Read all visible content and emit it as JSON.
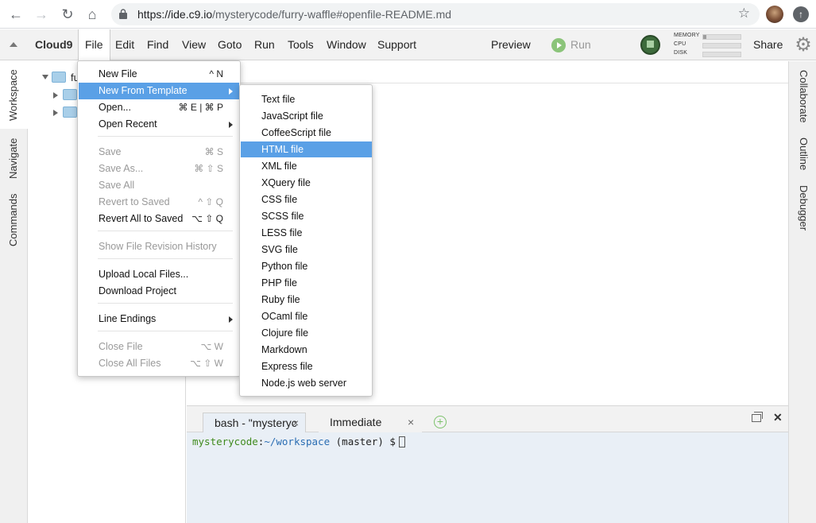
{
  "browser": {
    "url_host": "https://ide.c9.io",
    "url_path": "/mysterycode/furry-waffle#openfile-README.md"
  },
  "menubar": {
    "brand": "Cloud9",
    "items": [
      "File",
      "Edit",
      "Find",
      "View",
      "Goto",
      "Run",
      "Tools",
      "Window",
      "Support"
    ],
    "preview": "Preview",
    "run": "Run",
    "share": "Share",
    "stats": [
      {
        "label": "MEMORY",
        "fill": 0.08
      },
      {
        "label": "CPU",
        "fill": 0.0
      },
      {
        "label": "DISK",
        "fill": 0.0
      }
    ]
  },
  "left_tabs": [
    "Workspace",
    "Navigate",
    "Commands"
  ],
  "right_tabs": [
    "Collaborate",
    "Outline",
    "Debugger"
  ],
  "tree": {
    "root_label": "fu"
  },
  "file_menu": {
    "items": [
      {
        "label": "New File",
        "key": "^ N",
        "disabled": false
      },
      {
        "label": "New From Template",
        "key": "",
        "disabled": false,
        "submenu": true,
        "highlight": true
      },
      {
        "label": "Open...",
        "key": "⌘ E | ⌘ P",
        "disabled": false
      },
      {
        "label": "Open Recent",
        "key": "",
        "disabled": false,
        "submenu": true
      },
      {
        "label": "Save",
        "key": "⌘ S",
        "disabled": true
      },
      {
        "label": "Save As...",
        "key": "⌘ ⇧ S",
        "disabled": true
      },
      {
        "label": "Save All",
        "key": "",
        "disabled": true
      },
      {
        "label": "Revert to Saved",
        "key": "^ ⇧ Q",
        "disabled": true
      },
      {
        "label": "Revert All to Saved",
        "key": "⌥ ⇧ Q",
        "disabled": false
      },
      {
        "label": "Show File Revision History",
        "key": "",
        "disabled": true
      },
      {
        "label": "Upload Local Files...",
        "key": "",
        "disabled": false
      },
      {
        "label": "Download Project",
        "key": "",
        "disabled": false
      },
      {
        "label": "Line Endings",
        "key": "",
        "disabled": false,
        "submenu": true
      },
      {
        "label": "Close File",
        "key": "⌥ W",
        "disabled": true
      },
      {
        "label": "Close All Files",
        "key": "⌥ ⇧ W",
        "disabled": true
      }
    ]
  },
  "template_menu": {
    "items": [
      "Text file",
      "JavaScript file",
      "CoffeeScript file",
      "HTML file",
      "XML file",
      "XQuery file",
      "CSS file",
      "SCSS file",
      "LESS file",
      "SVG file",
      "Python file",
      "PHP file",
      "Ruby file",
      "OCaml file",
      "Clojure file",
      "Markdown",
      "Express file",
      "Node.js web server"
    ],
    "highlighted": "HTML file"
  },
  "terminal": {
    "tab1": "bash - \"mysteryc",
    "tab2": "Immediate",
    "prompt_user": "mysterycode",
    "prompt_path": "~/workspace",
    "prompt_rest": "(master) $"
  },
  "colors": {
    "menu_highlight": "#5aa0e6",
    "terminal_bg": "#e9eff6",
    "prompt_user": "#3f8a1d",
    "prompt_path": "#2a6db3"
  }
}
